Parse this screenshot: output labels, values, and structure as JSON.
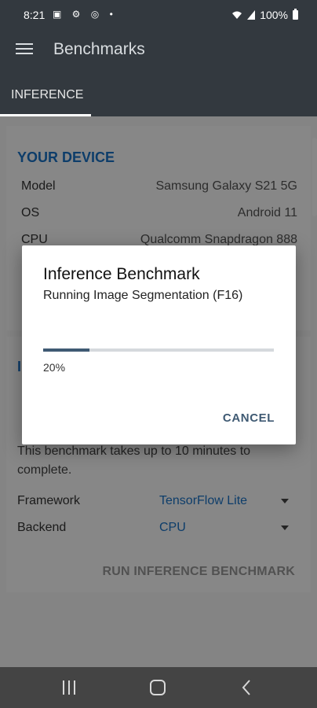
{
  "statusbar": {
    "time": "8:21",
    "icons": "▣ ⚙ ◎ •",
    "battery_text": "100%"
  },
  "appbar": {
    "title": "Benchmarks"
  },
  "tabs": [
    {
      "label": "INFERENCE"
    }
  ],
  "device": {
    "heading": "YOUR DEVICE",
    "rows": [
      {
        "key": "Model",
        "value": "Samsung Galaxy S21 5G"
      },
      {
        "key": "OS",
        "value": "Android 11"
      },
      {
        "key": "CPU",
        "value": "Qualcomm Snapdragon 888"
      }
    ]
  },
  "benchmark": {
    "heading": "I",
    "description_visible": "This benchmark takes up to 10 minutes to complete.",
    "fields": [
      {
        "label": "Framework",
        "value": "TensorFlow Lite"
      },
      {
        "label": "Backend",
        "value": "CPU"
      }
    ],
    "run_button": "RUN INFERENCE BENCHMARK"
  },
  "dialog": {
    "title": "Inference Benchmark",
    "subtitle": "Running Image Segmentation (F16)",
    "progress": 0.2,
    "progress_text": "20%",
    "cancel_label": "CANCEL"
  },
  "colors": {
    "accent": "#1a73c8",
    "progress": "#3f5a73",
    "appbar": "#33393f"
  }
}
